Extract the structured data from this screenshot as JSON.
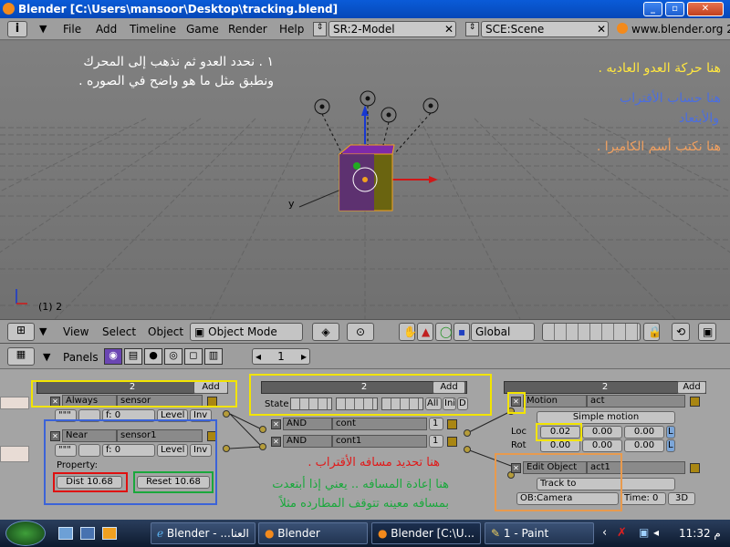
{
  "window": {
    "title": "Blender [C:\\Users\\mansoor\\Desktop\\tracking.blend]"
  },
  "menubar": {
    "items": [
      "File",
      "Add",
      "Timeline",
      "Game",
      "Render",
      "Help"
    ],
    "screen_field": "SR:2-Model",
    "scene_field": "SCE:Scene",
    "url": "www.blender.org 2"
  },
  "viewport": {
    "annotation_instructions_1": "١ . نحدد العدو ثم نذهب إلى المحرك",
    "annotation_instructions_2": "ونطبق مثل ما هو واضح في الصوره .",
    "annotation_enemy_motion": "هنا حركة العدو العاديه .",
    "annotation_approach_1": "هنا حساب الأقتراب",
    "annotation_approach_2": "والأبتعاد",
    "annotation_camera": "هنا نكتب أسم الكاميرا .",
    "axis_y": "y",
    "frame_label": "(1) 2"
  },
  "view_header": {
    "menus": [
      "View",
      "Select",
      "Object"
    ],
    "mode": "Object Mode",
    "transform_orientation": "Global"
  },
  "logic": {
    "panels_label": "Panels",
    "frame_value": "1",
    "sensors": {
      "column_title": "2",
      "add_label": "Add",
      "sensor1_type": "Always",
      "sensor1_name": "sensor",
      "pulse_label": "\"\"\"",
      "freq_label": "f: 0",
      "level_label": "Level",
      "inv_label": "Inv",
      "sensor2_type": "Near",
      "sensor2_name": "sensor1",
      "freq2_label": "f: 0",
      "property_label": "Property:",
      "dist_label": "Dist 10.68",
      "reset_label": "Reset 10.68"
    },
    "controllers": {
      "column_title": "2",
      "add_label": "Add",
      "state_label": "State",
      "all_label": "All",
      "ini_label": "Ini",
      "d_label": "D",
      "ctrl1_type": "AND",
      "ctrl1_name": "cont",
      "ctrl1_priority": "1",
      "ctrl2_type": "AND",
      "ctrl2_name": "cont1",
      "ctrl2_priority": "1",
      "note_near_distance": "هنا تحديد مسافه الأقتراب .",
      "note_reset_1": "هنا إعادة المسافه .. يعني إذا أبتعدت",
      "note_reset_2": "بمسافه معينه تتوقف المطارده مثلاً"
    },
    "actuators": {
      "column_title": "2",
      "add_label": "Add",
      "act1_type": "Motion",
      "act1_name": "act",
      "motion_mode": "Simple motion",
      "loc_label": "Loc",
      "rot_label": "Rot",
      "loc_x": "0.02",
      "loc_y": "0.00",
      "loc_z": "0.00",
      "rot_x": "0.00",
      "rot_y": "0.00",
      "rot_z": "0.00",
      "l_label": "L",
      "act2_type": "Edit Object",
      "act2_name": "act1",
      "track_mode": "Track to",
      "target_object": "OB:Camera",
      "time_label": "Time: 0",
      "threed_label": "3D"
    }
  },
  "taskbar": {
    "tasks": [
      "Blender - ...العنا",
      "Blender",
      "Blender [C:\\U...",
      "1 - Paint"
    ],
    "clock": "11:32 م"
  },
  "colors": {
    "highlight_yellow": "#f2e400",
    "highlight_blue": "#3b63d8",
    "highlight_red": "#e01010",
    "highlight_green": "#1aa83c",
    "highlight_orange": "#e89a4e",
    "ann_white": "#ffffff",
    "ann_yellow": "#ffe640",
    "ann_blue": "#4b6ee0",
    "ann_orange": "#f0a060",
    "ann_red": "#e01a1a",
    "ann_green": "#1aa83c"
  }
}
